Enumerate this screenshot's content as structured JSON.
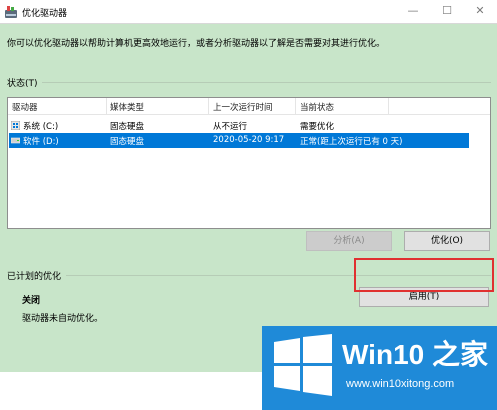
{
  "window": {
    "title": "优化驱动器",
    "controls": {
      "minimize": "—",
      "maximize": "☐",
      "close": "✕"
    }
  },
  "description": "你可以优化驱动器以帮助计算机更高效地运行，或者分析驱动器以了解是否需要对其进行优化。",
  "status_section": {
    "label": "状态(T)",
    "columns": [
      "驱动器",
      "媒体类型",
      "上一次运行时间",
      "当前状态"
    ],
    "rows": [
      {
        "drive": "系统 (C:)",
        "media": "固态硬盘",
        "last_run": "从不运行",
        "status": "需要优化",
        "selected": false,
        "icon": "windows-drive-icon"
      },
      {
        "drive": "软件 (D:)",
        "media": "固态硬盘",
        "last_run": "2020-05-20 9:17",
        "status": "正常(距上次运行已有 0 天)",
        "selected": true,
        "icon": "drive-icon"
      }
    ]
  },
  "buttons": {
    "analyze": "分析(A)",
    "optimize": "优化(O)",
    "enable": "启用(T)"
  },
  "scheduled_section": {
    "label": "已计划的优化",
    "state": "关闭",
    "detail": "驱动器未自动优化。"
  },
  "watermark": {
    "title": "Win10 之家",
    "subtitle": "www.win10xitong.com"
  },
  "colors": {
    "background": "#c8e5c9",
    "selection": "#0078d7",
    "highlight": "#e03030",
    "watermark": "#1f8ad8"
  }
}
